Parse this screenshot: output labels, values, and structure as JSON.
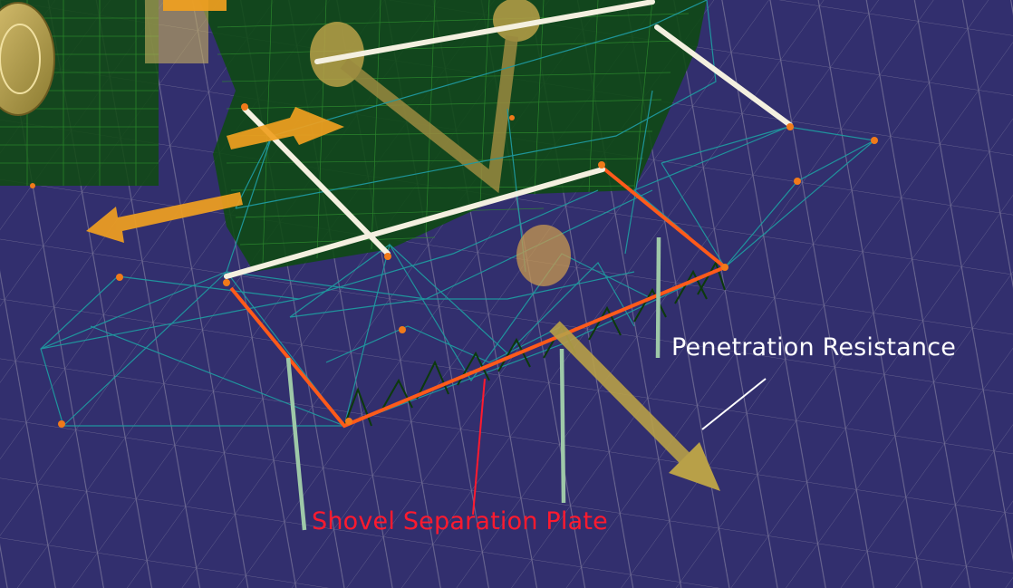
{
  "annotations": {
    "penetration_resistance": "Penetration Resistance",
    "shovel_separation_plate": "Shovel Separation Plate"
  },
  "colors": {
    "background": "#322f6e",
    "grid": "#8e8ba8",
    "force_arrow": "#f0a020",
    "resultant_arrow": "#b8a048",
    "wire_teal": "#1f9aa0",
    "wire_green": "#1b5e1b",
    "edge_orange": "#ff5a1a",
    "support_post": "#9ec8a8",
    "white_bar": "#f4f0e0",
    "label_red": "#ff1a2e",
    "label_white": "#ffffff"
  }
}
